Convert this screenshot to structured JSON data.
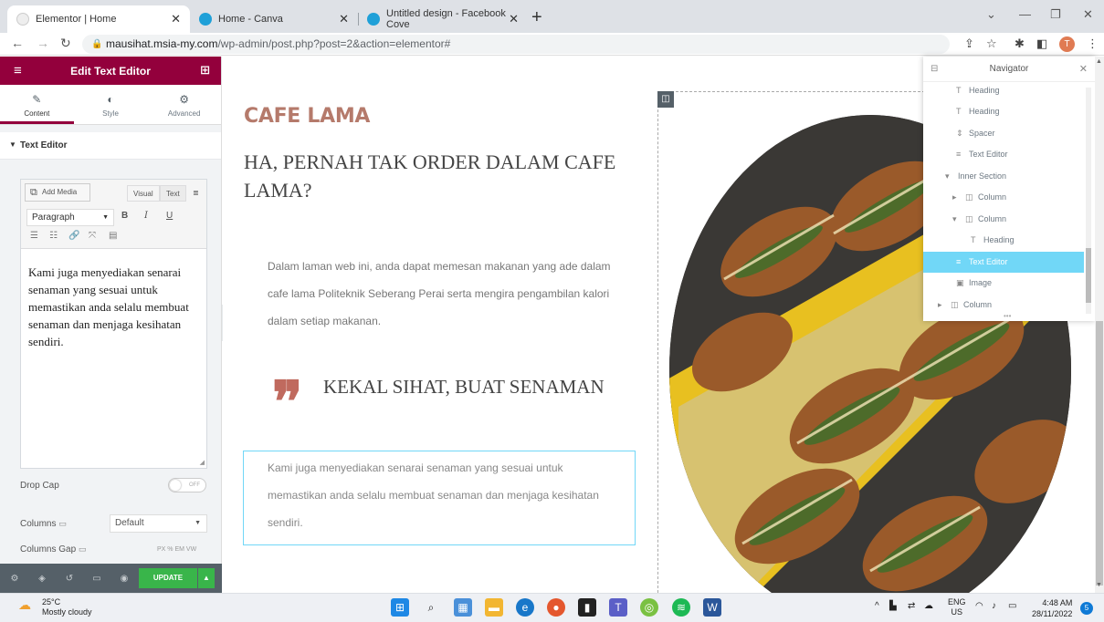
{
  "browser": {
    "tabs": [
      {
        "title": "Elementor | Home",
        "active": true
      },
      {
        "title": "Home - Canva",
        "active": false
      },
      {
        "title": "Untitled design - Facebook Cove",
        "active": false
      }
    ],
    "url_host": "mausihat.msia-my.com",
    "url_path": "/wp-admin/post.php?post=2&action=elementor#",
    "profile_initial": "T"
  },
  "panel": {
    "title": "Edit Text Editor",
    "tabs": [
      {
        "label": "Content",
        "icon": "pencil-icon"
      },
      {
        "label": "Style",
        "icon": "contrast-icon"
      },
      {
        "label": "Advanced",
        "icon": "gear-icon"
      }
    ],
    "section": "Text Editor",
    "editor": {
      "add_media": "Add Media",
      "visual_tab": "Visual",
      "text_tab": "Text",
      "format": "Paragraph",
      "bold": "B",
      "italic": "I",
      "underline": "U",
      "content": "Kami juga menyediakan senarai senaman yang sesuai untuk memastikan anda selalu membuat senaman dan menjaga kesihatan sendiri."
    },
    "drop_cap_label": "Drop Cap",
    "drop_cap_state": "OFF",
    "columns_label": "Columns",
    "columns_value": "Default",
    "columns_gap_label": "Columns Gap",
    "units": "PX % EM VW",
    "update_label": "UPDATE"
  },
  "page": {
    "brand": "CAFE LAMA",
    "heading": "HA, PERNAH TAK ORDER DALAM CAFE LAMA?",
    "intro": "Dalam laman web ini, anda dapat memesan makanan yang ade dalam cafe lama Politeknik Seberang Perai serta mengira pengambilan kalori dalam setiap makanan.",
    "quote_mark": "❞",
    "subheading": "KEKAL SIHAT, BUAT SENAMAN",
    "body": "Kami juga menyediakan senarai senaman yang sesuai untuk memastikan anda selalu membuat senaman dan menjaga kesihatan sendiri."
  },
  "navigator": {
    "title": "Navigator",
    "items": [
      {
        "label": "Heading",
        "icon": "T"
      },
      {
        "label": "Heading",
        "icon": "T"
      },
      {
        "label": "Spacer",
        "icon": "I"
      },
      {
        "label": "Text Editor",
        "icon": "≡"
      },
      {
        "label": "Inner Section",
        "icon": "▾"
      },
      {
        "label": "Column",
        "icon": "▸ ◫"
      },
      {
        "label": "Column",
        "icon": "▾ ◫"
      },
      {
        "label": "Heading",
        "icon": "T"
      },
      {
        "label": "Text Editor",
        "icon": "≡"
      },
      {
        "label": "Image",
        "icon": "▣"
      },
      {
        "label": "Column",
        "icon": "▸ ◫"
      }
    ]
  },
  "taskbar": {
    "temp": "25°C",
    "weather": "Mostly cloudy",
    "lang": "ENG",
    "region": "US",
    "time": "4:48 AM",
    "date": "28/11/2022",
    "notifications": "5"
  },
  "colors": {
    "elementor_brand": "#93003c",
    "accent_title": "#b57a6b",
    "quote": "#c06a5e",
    "selection": "#71d7f7",
    "update": "#39b54a"
  }
}
